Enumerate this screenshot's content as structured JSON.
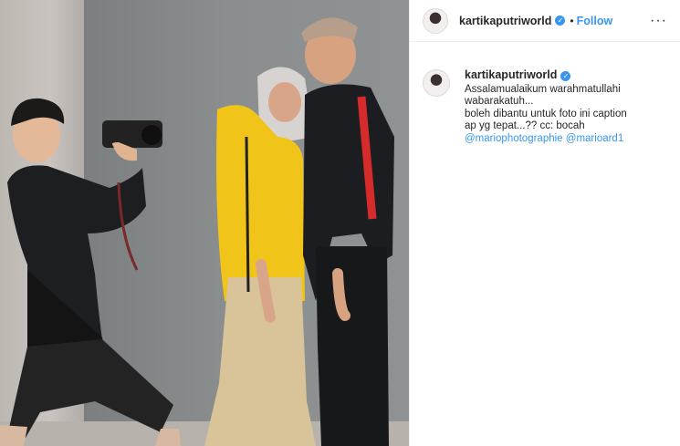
{
  "post": {
    "username": "kartikaputriworld",
    "verified_icon": "verified-badge-icon",
    "separator": "•",
    "follow_label": "Follow",
    "more_icon": "more-options-icon",
    "more_glyph": "···"
  },
  "caption": {
    "username": "kartikaputriworld",
    "lines": [
      "Assalamualaikum warahmatullahi",
      "wabarakatuh...",
      "boleh dibantu untuk foto ini caption",
      "ap yg tepat...?? cc: bocah"
    ],
    "mentions": [
      "@mariophotographie",
      "@marioard1"
    ]
  },
  "colors": {
    "accent": "#3897f0",
    "text": "#262626",
    "jacket_yellow": "#f0c419"
  }
}
